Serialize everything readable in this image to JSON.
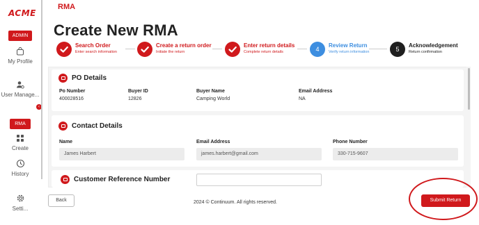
{
  "brand": {
    "logo": "ACME",
    "accent": "#d0191c",
    "step_active_color": "#3d8ee0"
  },
  "sidebar": {
    "admin_label": "ADMIN",
    "items": [
      {
        "label": "My Profile",
        "icon": "shopping-bag-icon"
      },
      {
        "label": "User Manage...",
        "icon": "user-cog-icon"
      },
      {
        "label": "RMA",
        "icon": ""
      },
      {
        "label": "Create",
        "icon": "grid-icon"
      },
      {
        "label": "History",
        "icon": "history-icon"
      },
      {
        "label": "Setti...",
        "icon": "gear-icon"
      }
    ],
    "collapse_glyph": "‹"
  },
  "header": {
    "section": "RMA",
    "title": "Create New RMA"
  },
  "stepper": [
    {
      "number": "",
      "title": "Search Order",
      "subtitle": "Enter search information",
      "state": "done"
    },
    {
      "number": "",
      "title": "Create a return order",
      "subtitle": "Initiate the return",
      "state": "done"
    },
    {
      "number": "",
      "title": "Enter return details",
      "subtitle": "Complete return details",
      "state": "done"
    },
    {
      "number": "4",
      "title": "Review Return",
      "subtitle": "Verify return information",
      "state": "active"
    },
    {
      "number": "5",
      "title": "Acknowledgement",
      "subtitle": "Return confirmation",
      "state": "pending"
    }
  ],
  "po_details": {
    "title": "PO Details",
    "fields": [
      {
        "label": "Po Number",
        "value": "400028516"
      },
      {
        "label": "Buyer ID",
        "value": "12826"
      },
      {
        "label": "Buyer Name",
        "value": "Camping World"
      },
      {
        "label": "Email Address",
        "value": "NA"
      }
    ]
  },
  "contact_details": {
    "title": "Contact Details",
    "fields": [
      {
        "label": "Name",
        "value": "James Harbert"
      },
      {
        "label": "Email Address",
        "value": "james.harbert@gmail.com"
      },
      {
        "label": "Phone Number",
        "value": "330-715-9607"
      }
    ]
  },
  "customer_reference": {
    "title": "Customer Reference Number",
    "value": ""
  },
  "footer": {
    "back_label": "Back",
    "copyright": "2024 © Continuum. All rights reserved.",
    "submit_label": "Submit Return"
  }
}
